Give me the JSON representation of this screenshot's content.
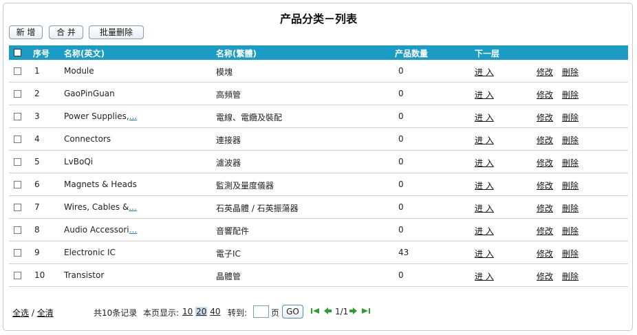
{
  "title": "产品分类－列表",
  "toolbar": {
    "add_label": "新 增",
    "merge_label": "合 并",
    "batch_delete_label": "批量删除"
  },
  "table": {
    "headers": {
      "index": "序号",
      "name_en": "名称(英文)",
      "name_tw": "名称(繁體)",
      "count": "产品数量",
      "next": "下一层"
    },
    "rows": [
      {
        "index": "1",
        "name_en": "Module",
        "more": "",
        "name_tw": "模塊",
        "count": "0"
      },
      {
        "index": "2",
        "name_en": "GaoPinGuan",
        "more": "",
        "name_tw": "高頻管",
        "count": "0"
      },
      {
        "index": "3",
        "name_en": "Power Supplies,",
        "more": "...",
        "name_tw": "電線、電纜及裝配",
        "count": "0"
      },
      {
        "index": "4",
        "name_en": "Connectors",
        "more": "",
        "name_tw": "連接器",
        "count": "0"
      },
      {
        "index": "5",
        "name_en": "LvBoQi",
        "more": "",
        "name_tw": "濾波器",
        "count": "0"
      },
      {
        "index": "6",
        "name_en": "Magnets & Heads",
        "more": "",
        "name_tw": "監測及量度儀器",
        "count": "0"
      },
      {
        "index": "7",
        "name_en": "Wires, Cables &",
        "more": "...",
        "name_tw": "石英晶體 / 石英振蕩器",
        "count": "0"
      },
      {
        "index": "8",
        "name_en": "Audio Accessori",
        "more": "...",
        "name_tw": "音響配件",
        "count": "0"
      },
      {
        "index": "9",
        "name_en": "Electronic IC",
        "more": "",
        "name_tw": "電子IC",
        "count": "43"
      },
      {
        "index": "10",
        "name_en": "Transistor",
        "more": "",
        "name_tw": "晶體管",
        "count": "0"
      }
    ],
    "enter_label": "进 入",
    "edit_label": "修改",
    "delete_label": "刪除"
  },
  "footer": {
    "select_all": "全选",
    "sep": "/",
    "clear_all": "全清",
    "total": "共10条记录",
    "per_page_label": "本页显示:",
    "page_sizes": [
      "10",
      "20",
      "40"
    ],
    "goto_label": "转到:",
    "page_unit": "页",
    "go_label": "GO",
    "page_info": "1/1"
  },
  "colors": {
    "header_bg": "#1a9cc4",
    "nav_arrow": "#2e9e2e"
  },
  "icons": {
    "first": "first-page-icon",
    "prev": "prev-page-icon",
    "next": "next-page-icon",
    "last": "last-page-icon"
  }
}
